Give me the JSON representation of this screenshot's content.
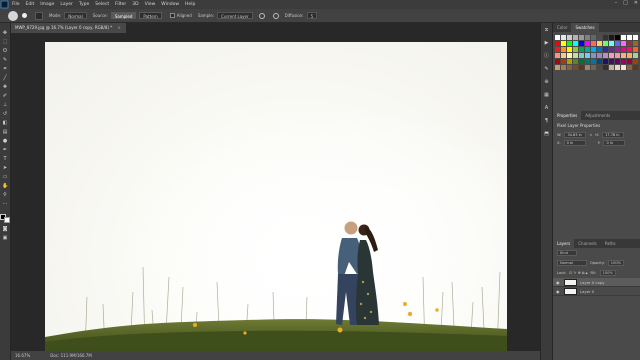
{
  "menubar": {
    "items": [
      "File",
      "Edit",
      "Image",
      "Layer",
      "Type",
      "Select",
      "Filter",
      "3D",
      "View",
      "Window",
      "Help"
    ]
  },
  "options": {
    "mode_label": "Mode:",
    "mode_value": "Normal",
    "source_label": "Source:",
    "sampled": "Sampled",
    "pattern": "Pattern",
    "aligned": "Aligned",
    "sample_label": "Sample:",
    "sample_value": "Current Layer",
    "diffusion_label": "Diffusion:",
    "diffusion_value": "5"
  },
  "document": {
    "tab_title": "MWP_8729.jpg @ 16.7% (Layer 0 copy, RGB/8) *",
    "zoom": "16.67%",
    "doc_info": "Doc: 111.9M/166.7M"
  },
  "panels": {
    "swatch_tabs": [
      "Color",
      "Swatches"
    ],
    "prop_tabs": [
      "Properties",
      "Adjustments"
    ],
    "pixel_layer": "Pixel Layer Properties",
    "w_label": "W:",
    "w_value": "34.63 in",
    "h_label": "H:",
    "h_value": "17.78 in",
    "go_label": "GO",
    "x_label": "X:",
    "x_value": "0 in",
    "y_label": "Y:",
    "y_value": "0 in",
    "layer_tabs": [
      "Layers",
      "Channels",
      "Paths"
    ],
    "kind": "Kind",
    "blend": "Normal",
    "opacity_label": "Opacity:",
    "opacity_value": "100%",
    "lock_label": "Lock:",
    "fill_label": "Fill:",
    "fill_value": "100%",
    "layers": [
      "Layer 0 copy",
      "Layer 0"
    ]
  },
  "colors": {
    "accent": "#31a8ff",
    "swatches": [
      "#ffffff",
      "#e6e6e6",
      "#cccccc",
      "#b3b3b3",
      "#999999",
      "#808080",
      "#666666",
      "#4d4d4d",
      "#333333",
      "#1a1a1a",
      "#000000",
      "#ffffff",
      "#ffffff",
      "#ffffff",
      "#ff0000",
      "#ffff00",
      "#00ff00",
      "#00ffff",
      "#0000ff",
      "#ff00ff",
      "#ff6666",
      "#ffcc66",
      "#66ff66",
      "#66ffff",
      "#6666ff",
      "#ff66ff",
      "#993333",
      "#996633",
      "#ed1c24",
      "#f7941d",
      "#fff200",
      "#8dc63f",
      "#00a651",
      "#00a99d",
      "#00aeef",
      "#0072bc",
      "#2e3192",
      "#662d91",
      "#92278f",
      "#ec008c",
      "#ed145b",
      "#f26522",
      "#f69679",
      "#fdc689",
      "#fff799",
      "#c4df9b",
      "#7accc8",
      "#6dcff6",
      "#8393ca",
      "#a186be",
      "#bd8cbf",
      "#f49ac1",
      "#f6989d",
      "#f9ad81",
      "#fbaf5d",
      "#a3d39c",
      "#9e0b0f",
      "#a0410d",
      "#aba000",
      "#598527",
      "#007236",
      "#00746b",
      "#0076a3",
      "#004a80",
      "#1b1464",
      "#440e62",
      "#630460",
      "#9e005d",
      "#9e0039",
      "#a0410d",
      "#c69c6d",
      "#a67c52",
      "#8c6239",
      "#754c24",
      "#603913",
      "#998675",
      "#736357",
      "#534741",
      "#362f2d",
      "#c7b299",
      "#e6d7c3",
      "#f2e6d6",
      "#8c6239",
      "#603913"
    ]
  }
}
